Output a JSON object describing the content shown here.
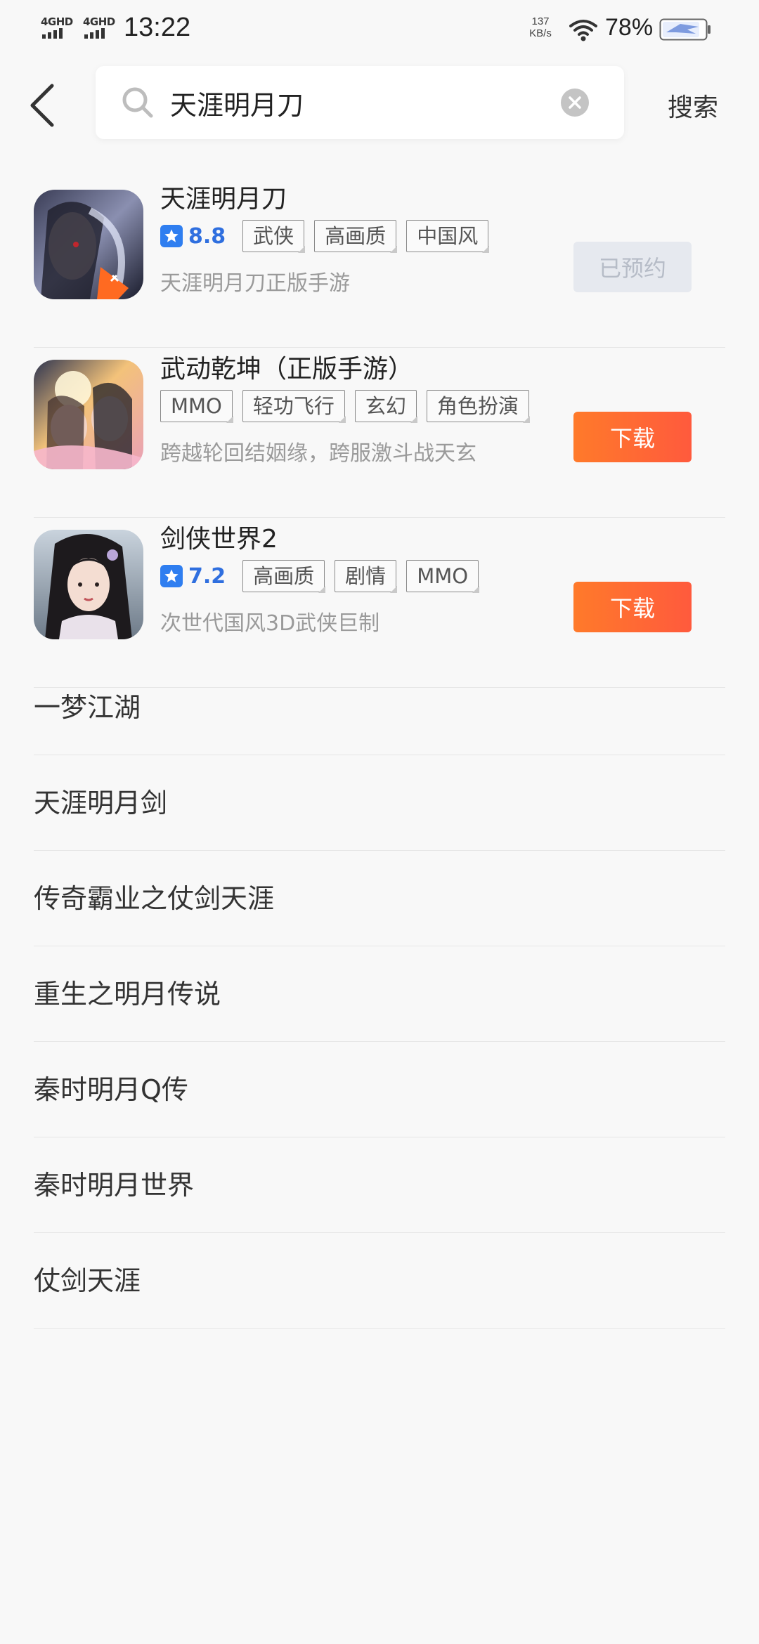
{
  "status_bar": {
    "network_1": "4GHD",
    "network_2": "4GHD",
    "time": "13:22",
    "speed_value": "137",
    "speed_unit": "KB/s",
    "battery": "78%"
  },
  "search": {
    "back_icon": "chevron-left-icon",
    "query": "天涯明月刀",
    "search_label": "搜索"
  },
  "colors": {
    "accent_blue": "#2f7ef0",
    "download_orange": "#ff6a35",
    "reserved_bg": "#e6e9ef"
  },
  "apps": [
    {
      "name": "天涯明月刀",
      "rating": "8.8",
      "tags": [
        "武侠",
        "高画质",
        "中国风"
      ],
      "description": "天涯明月刀正版手游",
      "action": "已预约"
    },
    {
      "name": "武动乾坤（正版手游）",
      "rating": "",
      "tags": [
        "MMO",
        "轻功飞行",
        "玄幻",
        "角色扮演"
      ],
      "description": "跨越轮回结姻缘，跨服激斗战天玄",
      "action": "下载"
    },
    {
      "name": "剑侠世界2",
      "rating": "7.2",
      "tags": [
        "高画质",
        "剧情",
        "MMO"
      ],
      "description": "次世代国风3D武侠巨制",
      "action": "下载"
    }
  ],
  "suggestions": [
    "一梦江湖",
    "天涯明月剑",
    "传奇霸业之仗剑天涯",
    "重生之明月传说",
    "秦时明月Q传",
    "秦时明月世界",
    "仗剑天涯"
  ]
}
